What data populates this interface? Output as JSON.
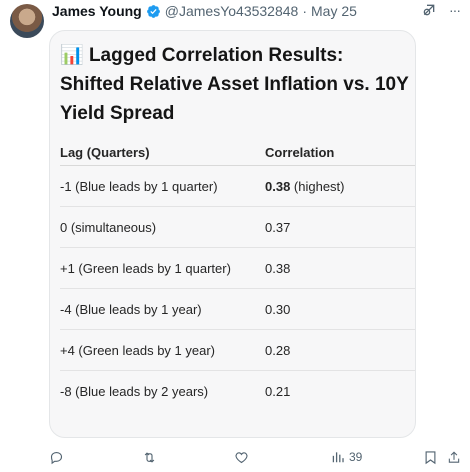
{
  "tweet": {
    "author_name": "James Young",
    "handle": "@JamesYo43532848",
    "separator": "·",
    "date": "May 25",
    "more": "···"
  },
  "card": {
    "title_emoji": "📊",
    "title": "Lagged Correlation Results: Shifted Relative Asset Inflation vs. 10Y Yield Spread",
    "columns": [
      "Lag (Quarters)",
      "Correlation"
    ],
    "rows": [
      {
        "lag": "-1 (Blue leads by 1 quarter)",
        "corr": "0.38",
        "note": " (highest)"
      },
      {
        "lag": "0 (simultaneous)",
        "corr": "0.37",
        "note": ""
      },
      {
        "lag": "+1 (Green leads by 1 quarter)",
        "corr": "0.38",
        "note": ""
      },
      {
        "lag": "-4 (Blue leads by 1 year)",
        "corr": "0.30",
        "note": ""
      },
      {
        "lag": "+4 (Green leads by 1 year)",
        "corr": "0.28",
        "note": ""
      },
      {
        "lag": "-8 (Blue leads by 2 years)",
        "corr": "0.21",
        "note": ""
      }
    ]
  },
  "actions": {
    "views": "39"
  },
  "icons": [
    "verified-badge-icon",
    "grok-icon",
    "more-icon",
    "reply-icon",
    "retweet-icon",
    "like-icon",
    "views-icon",
    "bookmark-icon",
    "share-icon"
  ],
  "colors": {
    "verified": "#1d9bf0",
    "muted": "#536471"
  }
}
